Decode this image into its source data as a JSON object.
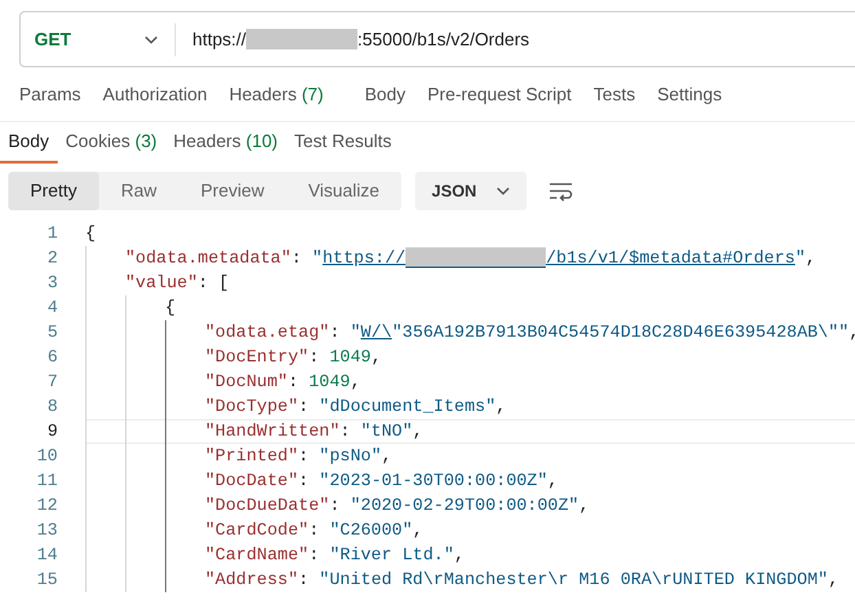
{
  "request": {
    "method": "GET",
    "url": [
      {
        "kind": "text",
        "text": "https://"
      },
      {
        "kind": "redaction"
      },
      {
        "kind": "text",
        "text": ":55000/b1s/v2/Orders"
      }
    ]
  },
  "request_tabs": [
    {
      "label": "Params",
      "selected": false
    },
    {
      "label": "Authorization",
      "selected": false
    },
    {
      "label": "Headers",
      "count": "(7)",
      "selected": false
    },
    {
      "label": "Body",
      "selected": false
    },
    {
      "label": "Pre-request Script",
      "selected": false
    },
    {
      "label": "Tests",
      "selected": false
    },
    {
      "label": "Settings",
      "selected": false
    }
  ],
  "response_tabs": [
    {
      "label": "Body",
      "selected": true
    },
    {
      "label": "Cookies",
      "count": "(3)",
      "selected": false
    },
    {
      "label": "Headers",
      "count": "(10)",
      "selected": false
    },
    {
      "label": "Test Results",
      "selected": false
    }
  ],
  "view_modes": [
    {
      "label": "Pretty",
      "selected": true
    },
    {
      "label": "Raw",
      "selected": false
    },
    {
      "label": "Preview",
      "selected": false
    },
    {
      "label": "Visualize",
      "selected": false
    }
  ],
  "format": "JSON",
  "code": [
    {
      "number": "1",
      "current": false,
      "tokens": [
        {
          "kind": "punct",
          "text": "{"
        }
      ],
      "children": [
        {
          "number": "2",
          "current": false,
          "tokens": [
            {
              "kind": "key",
              "text": "\"odata.metadata\""
            },
            {
              "kind": "punct",
              "text": ": "
            },
            {
              "kind": "string",
              "text": "\""
            },
            {
              "kind": "link",
              "text": "https://"
            },
            {
              "kind": "redaction"
            },
            {
              "kind": "link",
              "text": "/b1s/v1/$metadata#Orders"
            },
            {
              "kind": "string",
              "text": "\""
            },
            {
              "kind": "punct",
              "text": ","
            }
          ]
        },
        {
          "number": "3",
          "current": false,
          "tokens": [
            {
              "kind": "key",
              "text": "\"value\""
            },
            {
              "kind": "punct",
              "text": ": ["
            }
          ],
          "children": [
            {
              "number": "4",
              "current": false,
              "tokens": [
                {
                  "kind": "punct",
                  "text": "{"
                }
              ],
              "children": [
                {
                  "number": "5",
                  "current": false,
                  "tokens": [
                    {
                      "kind": "key",
                      "text": "\"odata.etag\""
                    },
                    {
                      "kind": "punct",
                      "text": ": "
                    },
                    {
                      "kind": "string",
                      "text": "\""
                    },
                    {
                      "kind": "link",
                      "text": "W/\\"
                    },
                    {
                      "kind": "string",
                      "text": "\"356A192B7913B04C54574D18C28D46E6395428AB\\\"\""
                    },
                    {
                      "kind": "punct",
                      "text": ","
                    }
                  ]
                },
                {
                  "number": "6",
                  "current": false,
                  "tokens": [
                    {
                      "kind": "key",
                      "text": "\"DocEntry\""
                    },
                    {
                      "kind": "punct",
                      "text": ": "
                    },
                    {
                      "kind": "number",
                      "text": "1049"
                    },
                    {
                      "kind": "punct",
                      "text": ","
                    }
                  ]
                },
                {
                  "number": "7",
                  "current": false,
                  "tokens": [
                    {
                      "kind": "key",
                      "text": "\"DocNum\""
                    },
                    {
                      "kind": "punct",
                      "text": ": "
                    },
                    {
                      "kind": "number",
                      "text": "1049"
                    },
                    {
                      "kind": "punct",
                      "text": ","
                    }
                  ]
                },
                {
                  "number": "8",
                  "current": false,
                  "tokens": [
                    {
                      "kind": "key",
                      "text": "\"DocType\""
                    },
                    {
                      "kind": "punct",
                      "text": ": "
                    },
                    {
                      "kind": "string",
                      "text": "\"dDocument_Items\""
                    },
                    {
                      "kind": "punct",
                      "text": ","
                    }
                  ]
                },
                {
                  "number": "9",
                  "current": true,
                  "tokens": [
                    {
                      "kind": "key",
                      "text": "\"HandWritten\""
                    },
                    {
                      "kind": "punct",
                      "text": ": "
                    },
                    {
                      "kind": "string",
                      "text": "\"tNO\""
                    },
                    {
                      "kind": "punct",
                      "text": ","
                    }
                  ]
                },
                {
                  "number": "10",
                  "current": false,
                  "tokens": [
                    {
                      "kind": "key",
                      "text": "\"Printed\""
                    },
                    {
                      "kind": "punct",
                      "text": ": "
                    },
                    {
                      "kind": "string",
                      "text": "\"psNo\""
                    },
                    {
                      "kind": "punct",
                      "text": ","
                    }
                  ]
                },
                {
                  "number": "11",
                  "current": false,
                  "tokens": [
                    {
                      "kind": "key",
                      "text": "\"DocDate\""
                    },
                    {
                      "kind": "punct",
                      "text": ": "
                    },
                    {
                      "kind": "string",
                      "text": "\"2023-01-30T00:00:00Z\""
                    },
                    {
                      "kind": "punct",
                      "text": ","
                    }
                  ]
                },
                {
                  "number": "12",
                  "current": false,
                  "tokens": [
                    {
                      "kind": "key",
                      "text": "\"DocDueDate\""
                    },
                    {
                      "kind": "punct",
                      "text": ": "
                    },
                    {
                      "kind": "string",
                      "text": "\"2020-02-29T00:00:00Z\""
                    },
                    {
                      "kind": "punct",
                      "text": ","
                    }
                  ]
                },
                {
                  "number": "13",
                  "current": false,
                  "tokens": [
                    {
                      "kind": "key",
                      "text": "\"CardCode\""
                    },
                    {
                      "kind": "punct",
                      "text": ": "
                    },
                    {
                      "kind": "string",
                      "text": "\"C26000\""
                    },
                    {
                      "kind": "punct",
                      "text": ","
                    }
                  ]
                },
                {
                  "number": "14",
                  "current": false,
                  "tokens": [
                    {
                      "kind": "key",
                      "text": "\"CardName\""
                    },
                    {
                      "kind": "punct",
                      "text": ": "
                    },
                    {
                      "kind": "string",
                      "text": "\"River Ltd.\""
                    },
                    {
                      "kind": "punct",
                      "text": ","
                    }
                  ]
                },
                {
                  "number": "15",
                  "current": false,
                  "tokens": [
                    {
                      "kind": "key",
                      "text": "\"Address\""
                    },
                    {
                      "kind": "punct",
                      "text": ": "
                    },
                    {
                      "kind": "string",
                      "text": "\"United Rd\\rManchester\\r M16 0RA\\rUNITED KINGDOM\""
                    },
                    {
                      "kind": "punct",
                      "text": ","
                    }
                  ]
                }
              ]
            }
          ]
        }
      ]
    }
  ]
}
